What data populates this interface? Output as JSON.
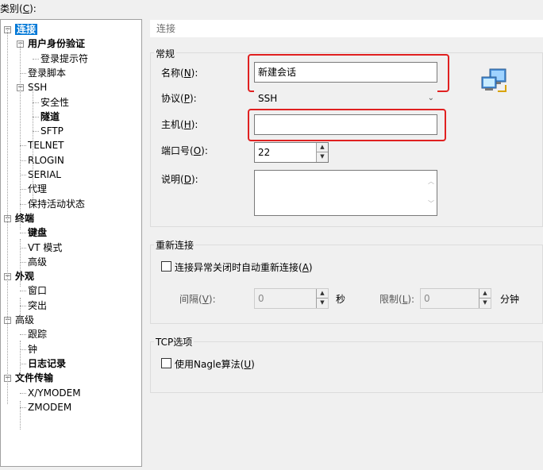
{
  "category_label": "类别(C):",
  "category_label_parts": {
    "pre": "类别(",
    "key": "C",
    "post": "):"
  },
  "tree": [
    {
      "label": "连接",
      "level": 0,
      "bold": true,
      "selected": true,
      "expander": "−"
    },
    {
      "label": "用户身份验证",
      "level": 1,
      "bold": true,
      "expander": "−"
    },
    {
      "label": "登录提示符",
      "level": 2
    },
    {
      "label": "登录脚本",
      "level": 1
    },
    {
      "label": "SSH",
      "level": 1,
      "expander": "−"
    },
    {
      "label": "安全性",
      "level": 2
    },
    {
      "label": "隧道",
      "level": 2,
      "bold": true
    },
    {
      "label": "SFTP",
      "level": 2
    },
    {
      "label": "TELNET",
      "level": 1
    },
    {
      "label": "RLOGIN",
      "level": 1
    },
    {
      "label": "SERIAL",
      "level": 1
    },
    {
      "label": "代理",
      "level": 1
    },
    {
      "label": "保持活动状态",
      "level": 1
    },
    {
      "label": "终端",
      "level": 0,
      "bold": true,
      "expander": "−"
    },
    {
      "label": "键盘",
      "level": 1,
      "bold": true
    },
    {
      "label": "VT 模式",
      "level": 1
    },
    {
      "label": "高级",
      "level": 1
    },
    {
      "label": "外观",
      "level": 0,
      "bold": true,
      "expander": "−"
    },
    {
      "label": "窗口",
      "level": 1
    },
    {
      "label": "突出",
      "level": 1
    },
    {
      "label": "高级",
      "level": 0,
      "expander": "−"
    },
    {
      "label": "跟踪",
      "level": 1
    },
    {
      "label": "钟",
      "level": 1
    },
    {
      "label": "日志记录",
      "level": 1,
      "bold": true
    },
    {
      "label": "文件传输",
      "level": 0,
      "bold": true,
      "expander": "−"
    },
    {
      "label": "X/YMODEM",
      "level": 1
    },
    {
      "label": "ZMODEM",
      "level": 1
    }
  ],
  "header": {
    "title": "连接"
  },
  "general": {
    "title": "常规",
    "name_label": {
      "pre": "名称(",
      "key": "N",
      "post": "):"
    },
    "name_value": "新建会话",
    "protocol_label": {
      "pre": "协议(",
      "key": "P",
      "post": "):"
    },
    "protocol_value": "SSH",
    "host_label": {
      "pre": "主机(",
      "key": "H",
      "post": "):"
    },
    "host_value": "",
    "port_label": {
      "pre": "端口号(",
      "key": "O",
      "post": "):"
    },
    "port_value": "22",
    "desc_label": {
      "pre": "说明(",
      "key": "D",
      "post": "):"
    },
    "desc_value": ""
  },
  "reconnect": {
    "title": "重新连接",
    "checkbox_label": {
      "pre": "连接异常关闭时自动重新连接(",
      "key": "A",
      "post": ")"
    },
    "interval_label": {
      "pre": "间隔(",
      "key": "V",
      "post": "):"
    },
    "interval_value": "0",
    "interval_unit": "秒",
    "limit_label": {
      "pre": "限制(",
      "key": "L",
      "post": "):"
    },
    "limit_value": "0",
    "limit_unit": "分钟"
  },
  "tcp": {
    "title": "TCP选项",
    "nagle_label": {
      "pre": "使用Nagle算法(",
      "key": "U",
      "post": ")"
    }
  },
  "colors": {
    "selection": "#0078d7",
    "highlight": "#e02020"
  },
  "icons": {
    "session": "network-computers-icon",
    "expander": "tree-expander-icon"
  }
}
